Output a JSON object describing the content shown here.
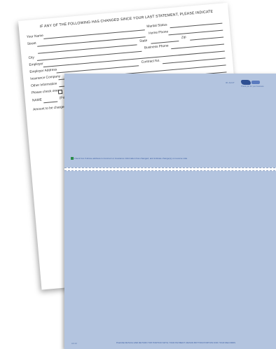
{
  "back_form": {
    "title": "IF ANY OF THE FOLLOWING HAS CHANGED SINCE YOUR LAST STATEMENT, PLEASE INDICATE",
    "fields": {
      "your_name": "Your Name",
      "marital_status": "Marital Status",
      "street": "Street",
      "home_phone": "Home Phone",
      "state": "State",
      "zip": "Zip",
      "city": "City",
      "business_phone": "Business Phone",
      "employer": "Employer",
      "employer_address": "Employer Address",
      "contract_no": "Contract No.",
      "insurance_company": "Insurance Company",
      "other_information": "Other Information",
      "please_check_one": "Please check one:",
      "name": "NAME",
      "print_hint": "(Print",
      "amount_charged": "Amount to be charged"
    }
  },
  "front_statement": {
    "account_label": "ID: ACCT",
    "logo_caption": "Thank you for your business",
    "check_note": "Check box if above address is incorrect or insurance information has changed, and indicate change(s) on reverse side.",
    "bottom_left_code": "LM-10",
    "bottom_note": "PLEASE DETACH AND RETURN TOP PORTION WITH YOUR PAYMENT. RETAIN BOTTOM PORTION FOR YOUR RECORDS"
  },
  "colors": {
    "statement_blue": "#b3c4df",
    "accent_blue": "#3b5ea3",
    "logo_blue": "#2e4f92",
    "check_green": "#2a8c4a"
  }
}
